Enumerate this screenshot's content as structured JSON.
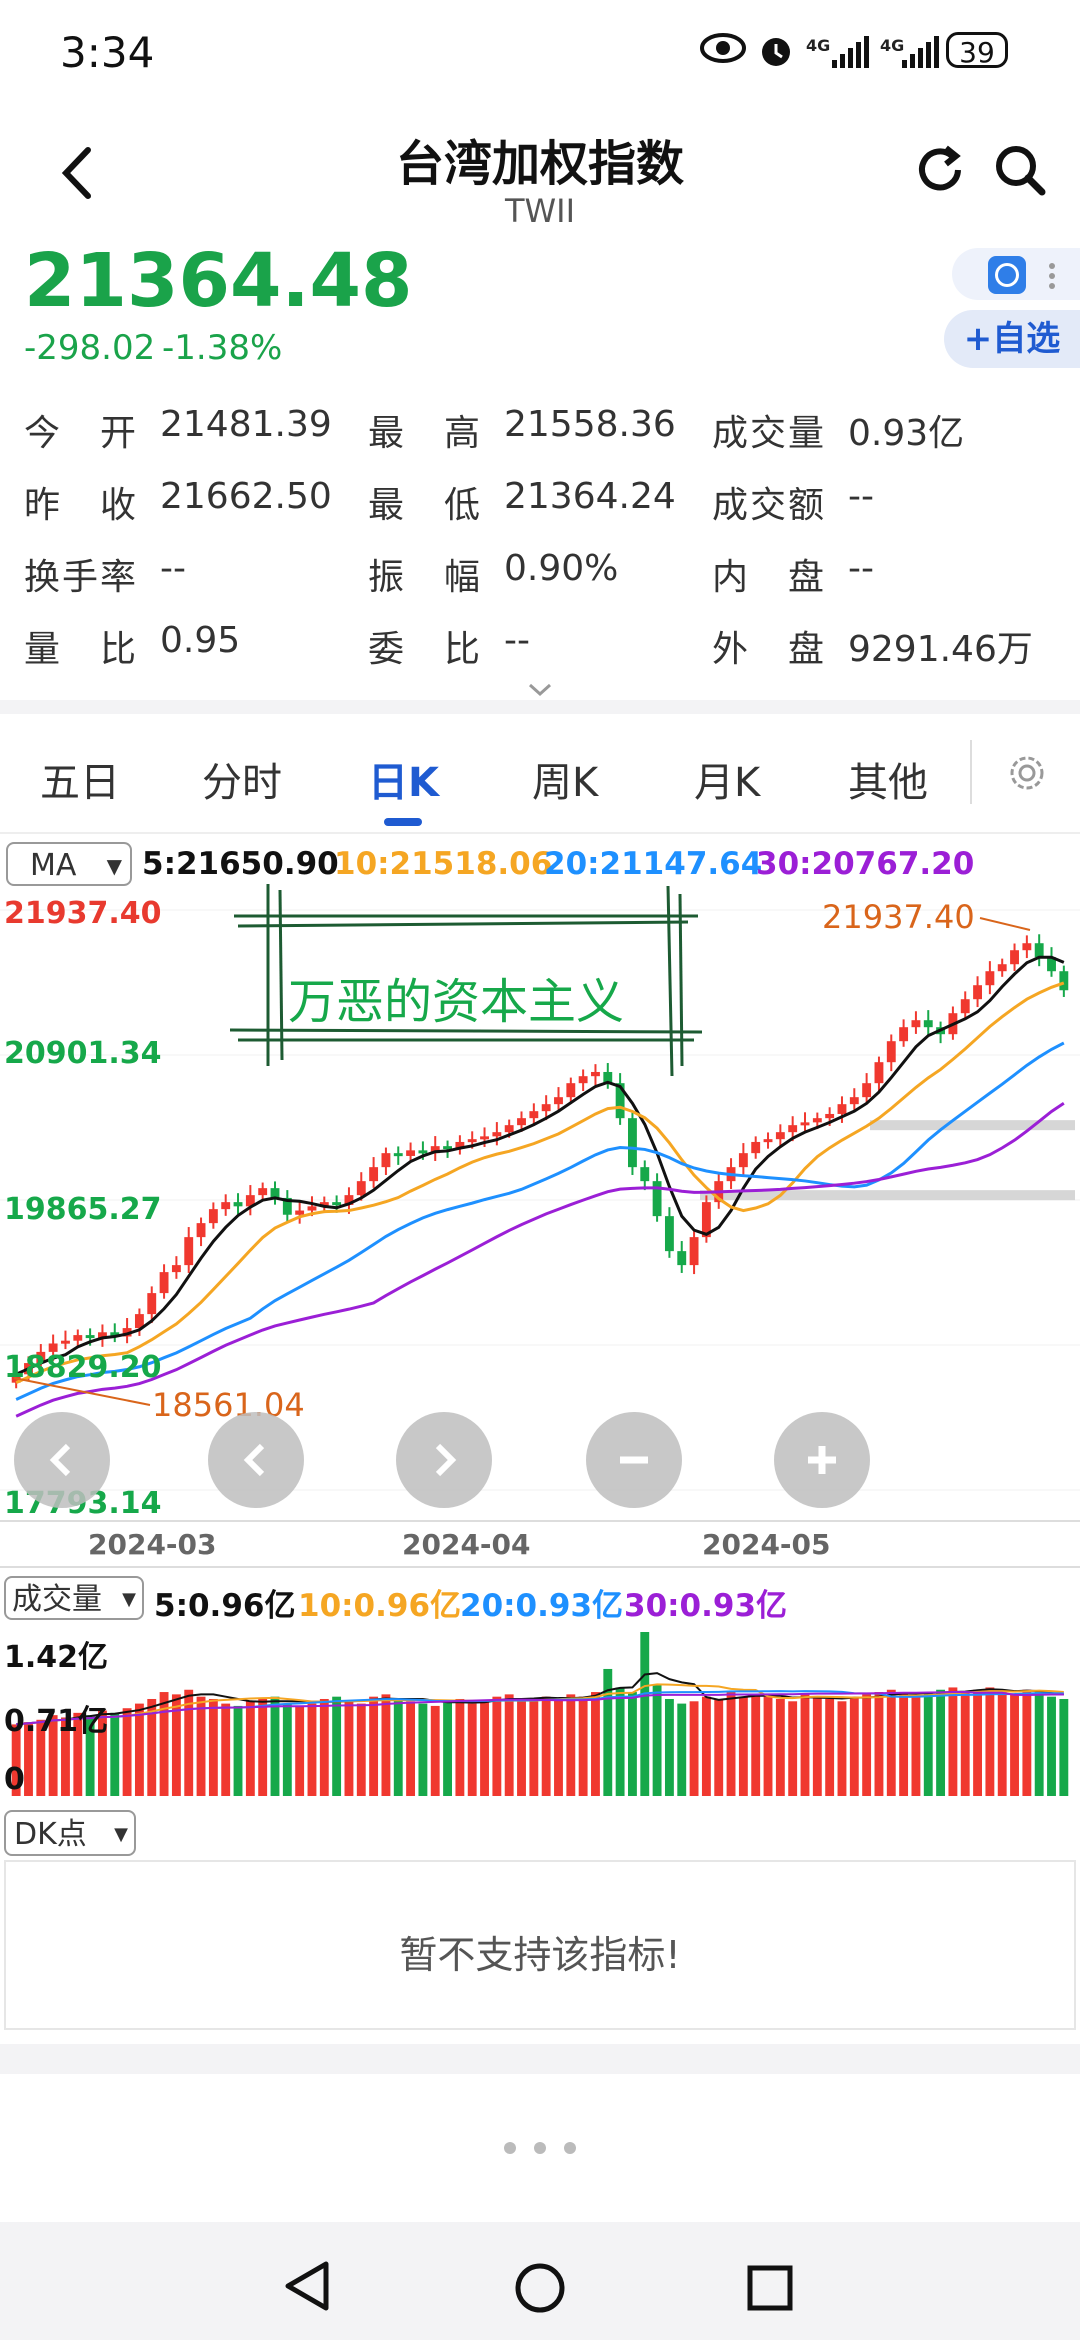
{
  "status": {
    "time": "3:34",
    "battery": "39",
    "net1": "4G",
    "net2": "4G"
  },
  "header": {
    "title": "台湾加权指数",
    "subtitle": "TWII"
  },
  "quote": {
    "price": "21364.48",
    "change": "-298.02",
    "change_pct": "-1.38%",
    "fav_label": "+自选"
  },
  "stats": [
    {
      "label": "今　开",
      "value": "21481.39"
    },
    {
      "label": "最　高",
      "value": "21558.36"
    },
    {
      "label": "成交量",
      "value": "0.93亿"
    },
    {
      "label": "昨　收",
      "value": "21662.50"
    },
    {
      "label": "最　低",
      "value": "21364.24"
    },
    {
      "label": "成交额",
      "value": "--"
    },
    {
      "label": "换手率",
      "value": "--"
    },
    {
      "label": "振　幅",
      "value": "0.90%"
    },
    {
      "label": "内　盘",
      "value": "--"
    },
    {
      "label": "量　比",
      "value": "0.95"
    },
    {
      "label": "委　比",
      "value": "--"
    },
    {
      "label": "外　盘",
      "value": "9291.46万"
    }
  ],
  "tabs": [
    {
      "label": "五日"
    },
    {
      "label": "分时"
    },
    {
      "label": "日K"
    },
    {
      "label": "周K"
    },
    {
      "label": "月K"
    },
    {
      "label": "其他"
    }
  ],
  "ma": {
    "select": "MA",
    "ma5": "5:21650.90",
    "ma10": "10:21518.06",
    "ma20": "20:21147.64",
    "ma30": "30:20767.20"
  },
  "overlay_text": "万恶的资本主义",
  "colors": {
    "up": "#f0382f",
    "down": "#16a84a",
    "ma5": "#111111",
    "ma10": "#f5a623",
    "ma20": "#1e90ff",
    "ma30": "#9b1fd6",
    "accent": "#1f5bd1"
  },
  "chart_data": {
    "type": "candlestick",
    "y_ticks": [
      "21937.40",
      "20901.34",
      "19865.27",
      "18829.20",
      "17793.14"
    ],
    "ylim": [
      17793.14,
      21937.4
    ],
    "x_labels": [
      "2024-03",
      "2024-04",
      "2024-05"
    ],
    "annotations": {
      "high": "21937.40",
      "low": "18561.04"
    },
    "close": [
      18620,
      18700,
      18780,
      18840,
      18860,
      18900,
      18880,
      18920,
      18890,
      18950,
      19050,
      19200,
      19350,
      19400,
      19600,
      19700,
      19800,
      19850,
      19820,
      19900,
      19950,
      19880,
      19760,
      19790,
      19820,
      19850,
      19830,
      19900,
      20000,
      20100,
      20200,
      20180,
      20220,
      20200,
      20250,
      20230,
      20280,
      20300,
      20320,
      20350,
      20400,
      20450,
      20500,
      20550,
      20600,
      20700,
      20750,
      20780,
      20700,
      20450,
      20100,
      20000,
      19750,
      19500,
      19400,
      19600,
      19850,
      20000,
      20100,
      20200,
      20280,
      20300,
      20350,
      20400,
      20420,
      20450,
      20480,
      20550,
      20600,
      20700,
      20850,
      21000,
      21100,
      21150,
      21100,
      21050,
      21200,
      21300,
      21400,
      21500,
      21550,
      21650,
      21700,
      21600,
      21500,
      21364
    ],
    "ma_values": {
      "ma5": "5:21650.90",
      "ma10": "10:21518.06",
      "ma20": "20:21147.64",
      "ma30": "30:20767.20"
    }
  },
  "volume": {
    "select": "成交量",
    "ma5": "5:0.96亿",
    "ma10": "10:0.96亿",
    "ma20": "20:0.93亿",
    "ma30": "30:0.93亿",
    "y_ticks": [
      "1.42亿",
      "0.71亿",
      "0"
    ],
    "values": [
      0.62,
      0.64,
      0.66,
      0.7,
      0.68,
      0.72,
      0.7,
      0.74,
      0.72,
      0.76,
      0.8,
      0.84,
      0.9,
      0.88,
      0.92,
      0.86,
      0.84,
      0.8,
      0.78,
      0.82,
      0.84,
      0.86,
      0.8,
      0.78,
      0.8,
      0.84,
      0.86,
      0.82,
      0.8,
      0.86,
      0.88,
      0.84,
      0.82,
      0.8,
      0.78,
      0.82,
      0.84,
      0.8,
      0.82,
      0.86,
      0.88,
      0.84,
      0.82,
      0.86,
      0.84,
      0.88,
      0.86,
      0.9,
      1.1,
      0.94,
      0.9,
      1.42,
      0.96,
      0.84,
      0.8,
      0.82,
      0.86,
      0.84,
      0.9,
      0.86,
      0.88,
      0.86,
      0.84,
      0.82,
      0.88,
      0.86,
      0.84,
      0.82,
      0.86,
      0.88,
      0.9,
      0.92,
      0.88,
      0.86,
      0.9,
      0.92,
      0.94,
      0.9,
      0.92,
      0.94,
      0.9,
      0.88,
      0.92,
      0.9,
      0.86,
      0.84
    ]
  },
  "dk": {
    "select": "DK点",
    "message": "暂不支持该指标!"
  }
}
